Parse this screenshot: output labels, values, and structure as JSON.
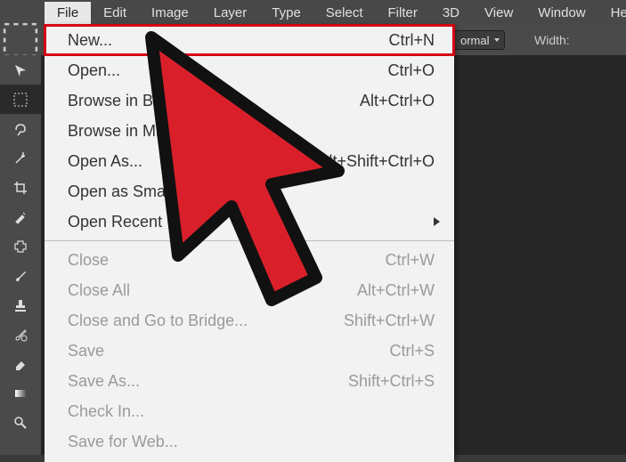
{
  "menubar": {
    "items": [
      "File",
      "Edit",
      "Image",
      "Layer",
      "Type",
      "Select",
      "Filter",
      "3D",
      "View",
      "Window",
      "Help"
    ],
    "active_index": 0
  },
  "optionsbar": {
    "select_label": "ormal",
    "width_label": "Width:"
  },
  "toolbar": {
    "tools": [
      "move-tool",
      "marquee-tool",
      "lasso-tool",
      "wand-tool",
      "crop-tool",
      "eyedropper-tool",
      "healing-tool",
      "brush-tool",
      "stamp-tool",
      "history-brush-tool",
      "eraser-tool",
      "gradient-tool",
      "dodge-tool"
    ],
    "selected_index": 1
  },
  "file_menu": {
    "items": [
      {
        "label": "New...",
        "shortcut": "Ctrl+N",
        "enabled": true,
        "highlight": true
      },
      {
        "label": "Open...",
        "shortcut": "Ctrl+O",
        "enabled": true
      },
      {
        "label": "Browse in Bridge...",
        "shortcut": "Alt+Ctrl+O",
        "enabled": true
      },
      {
        "label": "Browse in Mini Bridge...",
        "shortcut": "",
        "enabled": true
      },
      {
        "label": "Open As...",
        "shortcut": "Alt+Shift+Ctrl+O",
        "enabled": true
      },
      {
        "label": "Open as Smart Object...",
        "shortcut": "",
        "enabled": true
      },
      {
        "label": "Open Recent",
        "shortcut": "",
        "enabled": true,
        "submenu": true
      },
      {
        "sep": true
      },
      {
        "label": "Close",
        "shortcut": "Ctrl+W",
        "enabled": false
      },
      {
        "label": "Close All",
        "shortcut": "Alt+Ctrl+W",
        "enabled": false
      },
      {
        "label": "Close and Go to Bridge...",
        "shortcut": "Shift+Ctrl+W",
        "enabled": false
      },
      {
        "label": "Save",
        "shortcut": "Ctrl+S",
        "enabled": false
      },
      {
        "label": "Save As...",
        "shortcut": "Shift+Ctrl+S",
        "enabled": false
      },
      {
        "label": "Check In...",
        "shortcut": "",
        "enabled": false
      },
      {
        "label": "Save for Web...",
        "shortcut": "",
        "enabled": false
      }
    ]
  }
}
